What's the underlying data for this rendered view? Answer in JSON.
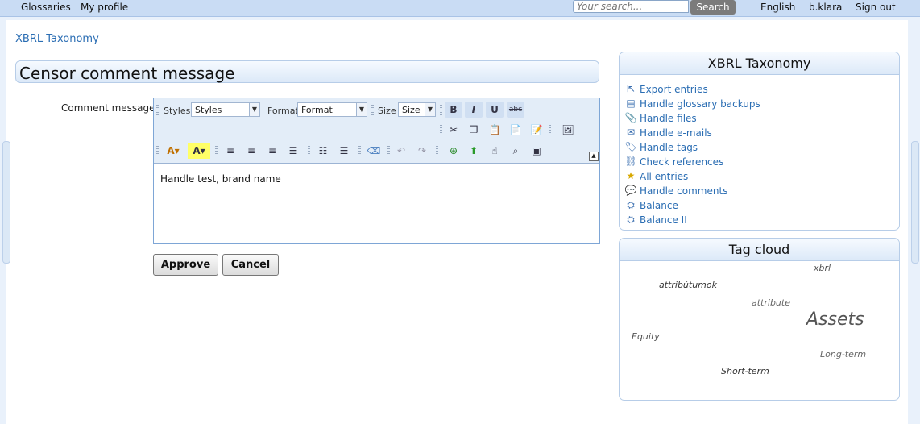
{
  "topnav": {
    "glossaries": "Glossaries",
    "my_profile": "My profile",
    "search_placeholder": "Your search...",
    "search_button": "Search",
    "language": "English",
    "user": "b.klara",
    "sign_out": "Sign out"
  },
  "breadcrumb": "XBRL Taxonomy",
  "page_title": "Censor comment message",
  "form": {
    "field_label": "Comment message:",
    "editor": {
      "styles_label": "Styles",
      "styles_value": "Styles",
      "format_label": "Format",
      "format_value": "Format",
      "size_label": "Size",
      "size_value": "Size",
      "bold": "B",
      "italic": "I",
      "underline": "U",
      "strike": "abc",
      "content": "Handle test, brand name"
    },
    "approve": "Approve",
    "cancel": "Cancel"
  },
  "sidebar_menu": {
    "title": "XBRL Taxonomy",
    "items": [
      {
        "label": "Export entries",
        "icon": "export-icon"
      },
      {
        "label": "Handle glossary backups",
        "icon": "backup-icon"
      },
      {
        "label": "Handle files",
        "icon": "files-icon"
      },
      {
        "label": "Handle e-mails",
        "icon": "email-icon"
      },
      {
        "label": "Handle tags",
        "icon": "tag-icon"
      },
      {
        "label": "Check references",
        "icon": "references-icon"
      },
      {
        "label": "All entries",
        "icon": "entries-icon"
      },
      {
        "label": "Handle comments",
        "icon": "comment-icon"
      },
      {
        "label": "Balance",
        "icon": "hierarchy-icon"
      },
      {
        "label": "Balance II",
        "icon": "hierarchy-icon"
      }
    ]
  },
  "tag_cloud": {
    "title": "Tag cloud",
    "tags": [
      "xbrl",
      "attribútumok",
      "attribute",
      "Assets",
      "Equity",
      "Long-term",
      "Short-term"
    ]
  },
  "colors": {
    "link": "#2a6db3",
    "topbar": "#c9dcf4",
    "search_button": "#7b7b7b"
  }
}
